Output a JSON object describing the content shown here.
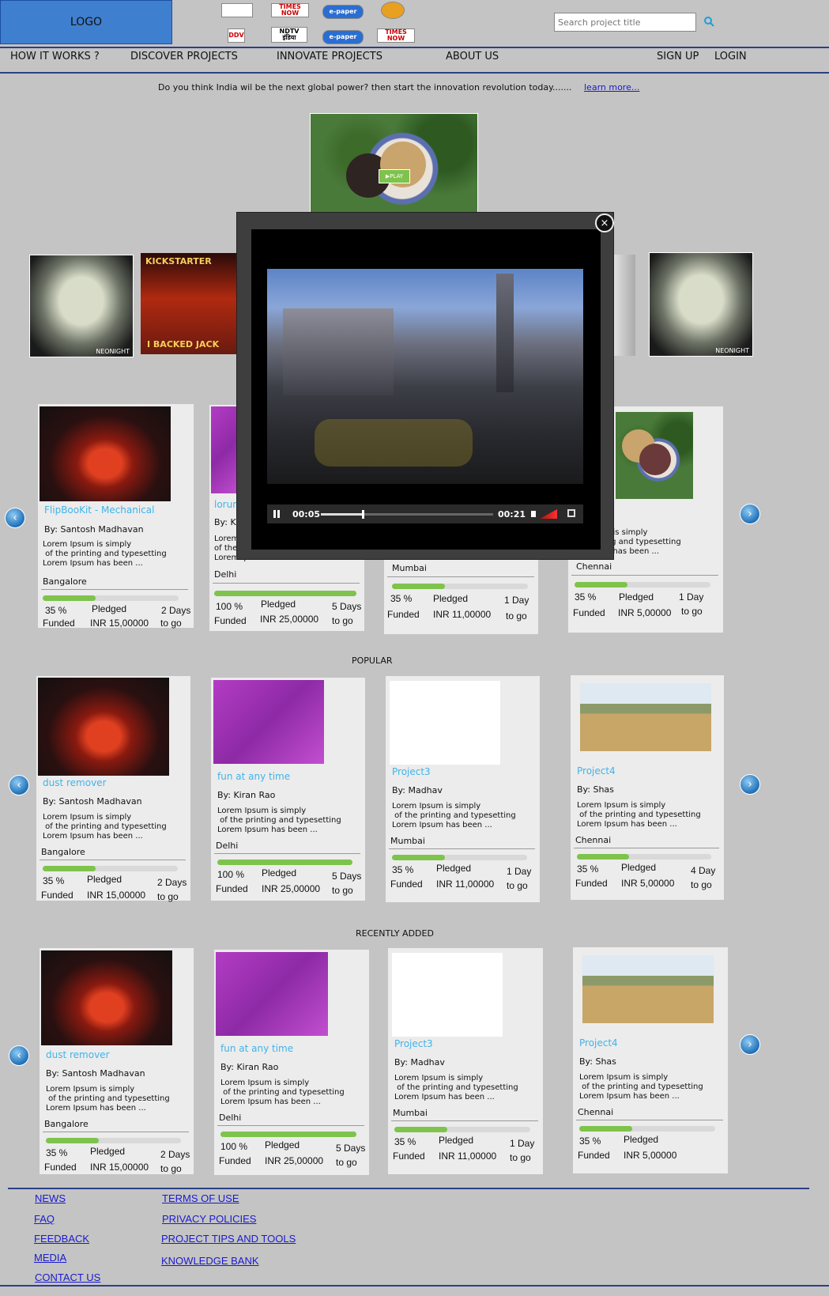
{
  "header": {
    "logo": "LOGO",
    "media_logos": [
      "TIMES NOW",
      "e-paper",
      "DDV",
      "NDTV इंडिया",
      "e-paper",
      "TIMES NOW"
    ],
    "search_placeholder": "Search project title"
  },
  "nav": {
    "how_it_works": "HOW IT WORKS ?",
    "discover": "DISCOVER PROJECTS",
    "innovate": "INNOVATE PROJECTS",
    "about": "ABOUT US",
    "signup": "SIGN UP",
    "login": "LOGIN"
  },
  "banner": {
    "tagline": "Do you think India wil be the next global power? then start the innovation revolution today.......",
    "learn_more": "learn more...",
    "play_label": "PLAY",
    "thumb_text_1": "NEONIGHT",
    "thumb_text_2": "KICKSTARTER",
    "thumb_text_3": "I BACKED JACK"
  },
  "video": {
    "current_time": "00:05",
    "duration": "00:21",
    "progress": 0.24,
    "close_label": "×"
  },
  "sections": {
    "popular": "POPULAR",
    "recent": "RECENTLY ADDED"
  },
  "featured": [
    {
      "title": "FlipBooKit - Mechanical",
      "by": "By: Santosh Madhavan",
      "desc": "Lorem Ipsum is simply\n of the printing and typesetting\nLorem Ipsum has been ...",
      "city": "Bangalore",
      "pct": "35 %",
      "funded": "Funded",
      "pledged": "Pledged",
      "amount": "INR 15,00000",
      "days": "2 Days",
      "togo": "to go",
      "fill": 0.39
    },
    {
      "title": "lorum",
      "by": "By: K",
      "desc": "Lorem\nof the\nLorem Ipsum has been ...",
      "city": "Delhi",
      "pct": "100 %",
      "funded": "Funded",
      "pledged": "Pledged",
      "amount": "INR 25,00000",
      "days": "5 Days",
      "togo": "to go",
      "fill": 1.0
    },
    {
      "city": "Mumbai",
      "pct": "35 %",
      "funded": "Funded",
      "pledged": "Pledged",
      "amount": "INR 11,00000",
      "days": "1 Day",
      "togo": "to go",
      "fill": 0.39
    },
    {
      "desc": "sum is simply\ninting and typesetting\nsum has been ...",
      "city": "Chennai",
      "pct": "35 %",
      "funded": "Funded",
      "pledged": "Pledged",
      "amount": "INR 5,00000",
      "days": "1 Day",
      "togo": "to go",
      "fill": 0.39
    }
  ],
  "popular": [
    {
      "title": "dust remover",
      "by": "By: Santosh Madhavan",
      "desc": "Lorem Ipsum is simply\n of the printing and typesetting\nLorem Ipsum has been ...",
      "city": "Bangalore",
      "pct": "35 %",
      "funded": "Funded",
      "pledged": "Pledged",
      "amount": "INR 15,00000",
      "days": "2 Days",
      "togo": "to go",
      "fill": 0.39
    },
    {
      "title": "fun at any time",
      "by": "By: Kiran Rao",
      "desc": "Lorem Ipsum is simply\n of the printing and typesetting\nLorem Ipsum has been ...",
      "city": "Delhi",
      "pct": "100 %",
      "funded": "Funded",
      "pledged": "Pledged",
      "amount": "INR 25,00000",
      "days": "5 Days",
      "togo": "to go",
      "fill": 1.0
    },
    {
      "title": "Project3",
      "by": "By: Madhav",
      "desc": "Lorem Ipsum is simply\n of the printing and typesetting\nLorem Ipsum has been ...",
      "city": "Mumbai",
      "pct": "35 %",
      "funded": "Funded",
      "pledged": "Pledged",
      "amount": "INR 11,00000",
      "days": "1 Day",
      "togo": "to go",
      "fill": 0.39
    },
    {
      "title": "Project4",
      "by": "By: Shas",
      "desc": "Lorem Ipsum is simply\n of the printing and typesetting\nLorem Ipsum has been ...",
      "city": "Chennai",
      "pct": "35 %",
      "funded": "Funded",
      "pledged": "Pledged",
      "amount": "INR 5,00000",
      "days": "4 Day",
      "togo": "to go",
      "fill": 0.39
    }
  ],
  "recent": [
    {
      "title": "dust remover",
      "by": "By: Santosh Madhavan",
      "desc": "Lorem Ipsum is simply\n of the printing and typesetting\nLorem Ipsum has been ...",
      "city": "Bangalore",
      "pct": "35 %",
      "funded": "Funded",
      "pledged": "Pledged",
      "amount": "INR 15,00000",
      "days": "2 Days",
      "togo": "to go",
      "fill": 0.39
    },
    {
      "title": "fun at any time",
      "by": "By: Kiran Rao",
      "desc": "Lorem Ipsum is simply\n of the printing and typesetting\nLorem Ipsum has been ...",
      "city": "Delhi",
      "pct": "100 %",
      "funded": "Funded",
      "pledged": "Pledged",
      "amount": "INR 25,00000",
      "days": "5 Days",
      "togo": "to go",
      "fill": 1.0
    },
    {
      "title": "Project3",
      "by": "By: Madhav",
      "desc": "Lorem Ipsum is simply\n of the printing and typesetting\nLorem Ipsum has been ...",
      "city": "Mumbai",
      "pct": "35 %",
      "funded": "Funded",
      "pledged": "Pledged",
      "amount": "INR 11,00000",
      "days": "1 Day",
      "togo": "to go",
      "fill": 0.39
    },
    {
      "title": "Project4",
      "by": "By: Shas",
      "desc": "Lorem Ipsum is simply\n of the printing and typesetting\nLorem Ipsum has been ...",
      "city": "Chennai",
      "pct": "35 %",
      "funded": "Funded",
      "pledged": "Pledged",
      "amount": "INR 5,00000",
      "days": "",
      "togo": "",
      "fill": 0.39
    }
  ],
  "footer": {
    "news": "NEWS",
    "faq": "FAQ",
    "feedback": "FEEDBACK",
    "media": "MEDIA",
    "contact": "CONTACT US",
    "terms": "TERMS OF USE",
    "privacy": "PRIVACY POLICIES",
    "tips": "PROJECT TIPS AND TOOLS",
    "knowledge": "KNOWLEDGE BANK"
  },
  "colors": {
    "accent_blue": "#3fb3ea",
    "progress_green": "#7ec34b",
    "rule_navy": "#2c3f86",
    "link_blue": "#1a1ad0"
  }
}
